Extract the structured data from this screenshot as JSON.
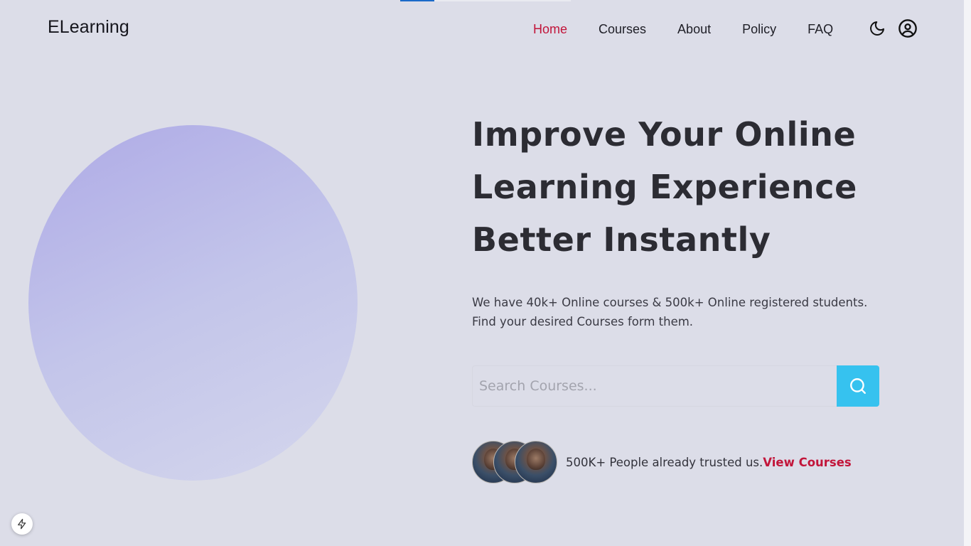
{
  "brand": "ELearning",
  "nav": [
    {
      "label": "Home",
      "active": true
    },
    {
      "label": "Courses",
      "active": false
    },
    {
      "label": "About",
      "active": false
    },
    {
      "label": "Policy",
      "active": false
    },
    {
      "label": "FAQ",
      "active": false
    }
  ],
  "icons": {
    "theme_toggle": "moon-icon",
    "account": "user-circle-icon",
    "search": "search-icon",
    "dev_tool": "lightning-icon"
  },
  "hero": {
    "headline_lines": [
      "Improve Your Online",
      "Learning Experience",
      "Better Instantly"
    ],
    "description_lines": [
      "We have 40k+ Online courses & 500k+ Online registered students.",
      "Find your desired Courses form them."
    ]
  },
  "search": {
    "placeholder": "Search Courses...",
    "value": ""
  },
  "trust": {
    "text": "500K+ People already trusted us.",
    "link_label": "View Courses"
  },
  "colors": {
    "background": "#dcdde8",
    "accent_link": "#c2153a",
    "search_button": "#36c2ef",
    "blob_start": "#aeaae6",
    "blob_end": "#d4d6ec"
  }
}
